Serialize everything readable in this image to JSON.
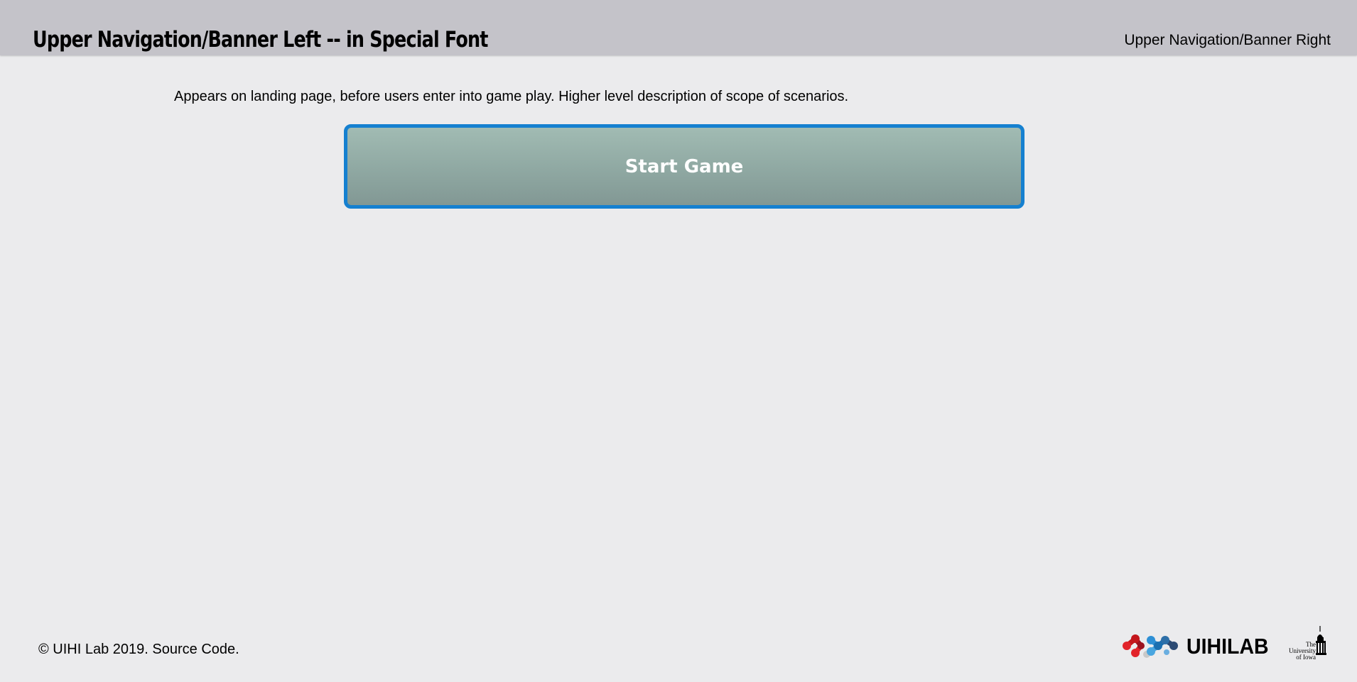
{
  "banner": {
    "left_title": "Upper Navigation/Banner Left -- in Special Font",
    "right_title": "Upper Navigation/Banner Right",
    "background": "#c4c3c9"
  },
  "main": {
    "description": "Appears on landing page, before users enter into game play. Higher level description of scope of scenarios.",
    "start_button_label": "Start Game",
    "start_button_border": "#1580d0"
  },
  "footer": {
    "copyright": "© UIHI Lab 2019.",
    "source_link": "Source Code.",
    "lab_logo_text": "UIHILAB",
    "university_logo_lines": [
      "The",
      "University",
      "of Iowa"
    ]
  },
  "icons": {
    "lab_logo": "uihilab-molecule-icon",
    "university_logo": "university-of-iowa-tower-icon"
  }
}
